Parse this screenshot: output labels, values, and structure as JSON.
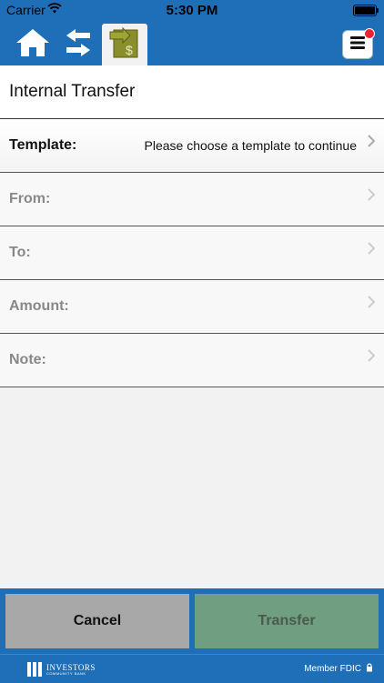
{
  "status_bar": {
    "carrier": "Carrier",
    "time": "5:30 PM"
  },
  "nav": {
    "icons": [
      "home-icon",
      "transfer-arrows-icon",
      "bill-pay-icon",
      "menu-icon"
    ],
    "active": "bill-pay-icon"
  },
  "page": {
    "title": "Internal Transfer"
  },
  "form": {
    "rows": [
      {
        "label": "Template:",
        "value": "Please choose a template to continue"
      },
      {
        "label": "From:",
        "value": ""
      },
      {
        "label": "To:",
        "value": ""
      },
      {
        "label": "Amount:",
        "value": ""
      },
      {
        "label": "Note:",
        "value": ""
      }
    ]
  },
  "actions": {
    "cancel": "Cancel",
    "transfer": "Transfer"
  },
  "footer": {
    "logo_name": "INVESTORS",
    "logo_sub": "COMMUNITY BANK",
    "member": "Member FDIC"
  },
  "colors": {
    "brand_blue": "#1f6fb8",
    "cancel_bg": "#a8a8a8",
    "transfer_bg": "#6f9e80",
    "badge_red": "#e22233"
  }
}
